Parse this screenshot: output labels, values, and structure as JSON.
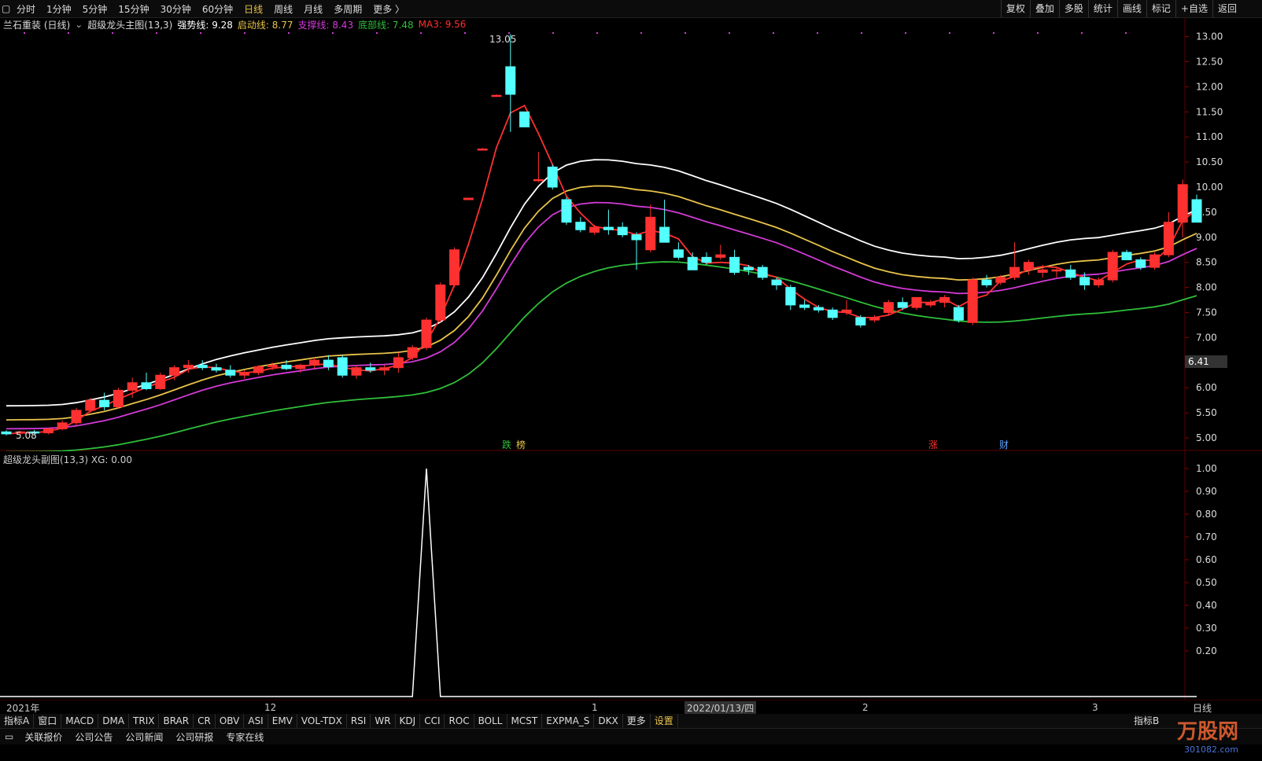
{
  "topbar": {
    "periods": [
      "分时",
      "1分钟",
      "5分钟",
      "15分钟",
      "30分钟",
      "60分钟",
      "日线",
      "周线",
      "月线",
      "多周期",
      "更多 〉"
    ],
    "active": "日线",
    "tools": [
      "复权",
      "叠加",
      "多股",
      "统计",
      "画线",
      "标记",
      "+自选",
      "返回"
    ]
  },
  "title_row": {
    "stock": "兰石重装 (日线)",
    "indicator": "超级龙头主图(13,3)",
    "items": [
      {
        "label": "强势线: 9.28",
        "color": "#ffffff"
      },
      {
        "label": "启动线: 8.77",
        "color": "#e8c34a"
      },
      {
        "label": "支撑线: 8.43",
        "color": "#d23ad6"
      },
      {
        "label": "底部线: 7.48",
        "color": "#2fbf3a"
      },
      {
        "label": "MA3: 9.56",
        "color": "#ff3030"
      }
    ]
  },
  "sub_title": "超级龙头副图(13,3)  XG: 0.00",
  "price_tag": "6.41",
  "high_label": "13.05",
  "low_label": "5.08",
  "markers": [
    {
      "text": "跌",
      "color": "#2fbf3a"
    },
    {
      "text": "榜",
      "color": "#e8c34a"
    },
    {
      "text": "涨",
      "color": "#ff3030"
    },
    {
      "text": "财",
      "color": "#5aa0ff"
    }
  ],
  "x_axis": [
    "2021年",
    "12",
    "1",
    "2022/01/13/四",
    "2",
    "3",
    "日线"
  ],
  "indicator_tabs": [
    "指标A",
    "窗口",
    "MACD",
    "DMA",
    "TRIX",
    "BRAR",
    "CR",
    "OBV",
    "ASI",
    "EMV",
    "VOL-TDX",
    "RSI",
    "WR",
    "KDJ",
    "CCI",
    "ROC",
    "BOLL",
    "MCST",
    "EXPMA_S",
    "DKX",
    "更多",
    "设置",
    "指标B"
  ],
  "news_tabs": [
    "关联报价",
    "公司公告",
    "公司新闻",
    "公司研报",
    "专家在线"
  ],
  "watermark": "万股网",
  "watermark_url": "301082.com",
  "chart_data": {
    "type": "candlestick",
    "price_axis": {
      "ticks": [
        13.0,
        12.5,
        12.0,
        11.5,
        11.0,
        10.5,
        10.0,
        9.5,
        9.0,
        8.5,
        8.0,
        7.5,
        7.0,
        6.5,
        6.0,
        5.5,
        5.0
      ]
    },
    "sub_axis": {
      "ticks": [
        1.0,
        0.9,
        0.8,
        0.7,
        0.6,
        0.5,
        0.4,
        0.3,
        0.2
      ]
    },
    "candles": [
      [
        5.12,
        5.15,
        5.05,
        5.08
      ],
      [
        5.1,
        5.14,
        5.06,
        5.12
      ],
      [
        5.12,
        5.16,
        5.08,
        5.1
      ],
      [
        5.1,
        5.2,
        5.07,
        5.18
      ],
      [
        5.18,
        5.35,
        5.15,
        5.3
      ],
      [
        5.3,
        5.6,
        5.25,
        5.55
      ],
      [
        5.55,
        5.8,
        5.5,
        5.75
      ],
      [
        5.75,
        5.9,
        5.55,
        5.62
      ],
      [
        5.62,
        6.0,
        5.58,
        5.95
      ],
      [
        5.95,
        6.2,
        5.8,
        6.1
      ],
      [
        6.1,
        6.3,
        5.95,
        5.98
      ],
      [
        5.98,
        6.3,
        5.95,
        6.25
      ],
      [
        6.25,
        6.45,
        6.15,
        6.4
      ],
      [
        6.4,
        6.55,
        6.3,
        6.45
      ],
      [
        6.45,
        6.55,
        6.35,
        6.4
      ],
      [
        6.4,
        6.48,
        6.3,
        6.35
      ],
      [
        6.35,
        6.45,
        6.2,
        6.25
      ],
      [
        6.25,
        6.35,
        6.18,
        6.3
      ],
      [
        6.3,
        6.45,
        6.25,
        6.42
      ],
      [
        6.42,
        6.5,
        6.35,
        6.45
      ],
      [
        6.45,
        6.55,
        6.35,
        6.38
      ],
      [
        6.38,
        6.48,
        6.3,
        6.45
      ],
      [
        6.45,
        6.6,
        6.38,
        6.55
      ],
      [
        6.55,
        6.65,
        6.35,
        6.42
      ],
      [
        6.6,
        6.65,
        6.2,
        6.25
      ],
      [
        6.25,
        6.45,
        6.18,
        6.4
      ],
      [
        6.4,
        6.5,
        6.3,
        6.35
      ],
      [
        6.35,
        6.45,
        6.25,
        6.4
      ],
      [
        6.4,
        6.7,
        6.3,
        6.6
      ],
      [
        6.6,
        6.85,
        6.55,
        6.8
      ],
      [
        6.8,
        7.4,
        6.75,
        7.35
      ],
      [
        7.35,
        8.1,
        7.3,
        8.05
      ],
      [
        8.05,
        8.8,
        8.0,
        8.75
      ],
      [
        9.75,
        9.78,
        9.75,
        9.78
      ],
      [
        10.76,
        10.78,
        10.76,
        10.76
      ],
      [
        11.83,
        11.85,
        11.83,
        11.83
      ],
      [
        12.4,
        13.05,
        11.1,
        11.85
      ],
      [
        11.5,
        11.5,
        11.2,
        11.2
      ],
      [
        10.15,
        10.7,
        10.1,
        10.15
      ],
      [
        10.4,
        10.45,
        9.95,
        10.0
      ],
      [
        9.75,
        9.8,
        9.25,
        9.3
      ],
      [
        9.3,
        9.4,
        9.1,
        9.15
      ],
      [
        9.1,
        9.25,
        9.05,
        9.2
      ],
      [
        9.2,
        9.55,
        9.05,
        9.15
      ],
      [
        9.2,
        9.3,
        9.0,
        9.05
      ],
      [
        9.05,
        9.1,
        8.35,
        8.95
      ],
      [
        8.75,
        9.65,
        8.7,
        9.4
      ],
      [
        9.2,
        9.75,
        8.9,
        8.9
      ],
      [
        8.75,
        8.9,
        8.55,
        8.6
      ],
      [
        8.6,
        8.7,
        8.35,
        8.35
      ],
      [
        8.6,
        8.7,
        8.45,
        8.5
      ],
      [
        8.6,
        8.85,
        8.55,
        8.65
      ],
      [
        8.6,
        8.75,
        8.25,
        8.3
      ],
      [
        8.4,
        8.45,
        8.25,
        8.35
      ],
      [
        8.4,
        8.45,
        8.15,
        8.2
      ],
      [
        8.15,
        8.2,
        7.95,
        8.05
      ],
      [
        8.0,
        8.05,
        7.55,
        7.65
      ],
      [
        7.65,
        7.75,
        7.55,
        7.6
      ],
      [
        7.6,
        7.65,
        7.5,
        7.55
      ],
      [
        7.55,
        7.6,
        7.35,
        7.4
      ],
      [
        7.5,
        7.75,
        7.45,
        7.55
      ],
      [
        7.4,
        7.45,
        7.2,
        7.25
      ],
      [
        7.35,
        7.45,
        7.3,
        7.4
      ],
      [
        7.5,
        7.75,
        7.45,
        7.7
      ],
      [
        7.7,
        7.8,
        7.55,
        7.6
      ],
      [
        7.6,
        7.8,
        7.55,
        7.8
      ],
      [
        7.65,
        7.75,
        7.6,
        7.7
      ],
      [
        7.7,
        7.85,
        7.6,
        7.8
      ],
      [
        7.6,
        7.65,
        7.3,
        7.35
      ],
      [
        7.3,
        8.2,
        7.25,
        8.15
      ],
      [
        8.15,
        8.25,
        8.0,
        8.05
      ],
      [
        8.1,
        8.25,
        8.05,
        8.2
      ],
      [
        8.2,
        8.9,
        8.15,
        8.4
      ],
      [
        8.35,
        8.55,
        8.25,
        8.5
      ],
      [
        8.3,
        8.45,
        8.2,
        8.35
      ],
      [
        8.35,
        8.4,
        8.2,
        8.35
      ],
      [
        8.35,
        8.45,
        8.15,
        8.2
      ],
      [
        8.2,
        8.3,
        7.95,
        8.05
      ],
      [
        8.05,
        8.2,
        8.0,
        8.15
      ],
      [
        8.15,
        8.75,
        8.1,
        8.7
      ],
      [
        8.7,
        8.75,
        8.55,
        8.55
      ],
      [
        8.55,
        8.6,
        8.35,
        8.4
      ],
      [
        8.4,
        8.7,
        8.35,
        8.65
      ],
      [
        8.65,
        9.5,
        8.6,
        9.3
      ],
      [
        9.3,
        10.15,
        9.0,
        10.05
      ],
      [
        9.75,
        9.85,
        9.3,
        9.3
      ]
    ],
    "xg": {
      "spike_index": 30,
      "value": 1.0
    }
  }
}
